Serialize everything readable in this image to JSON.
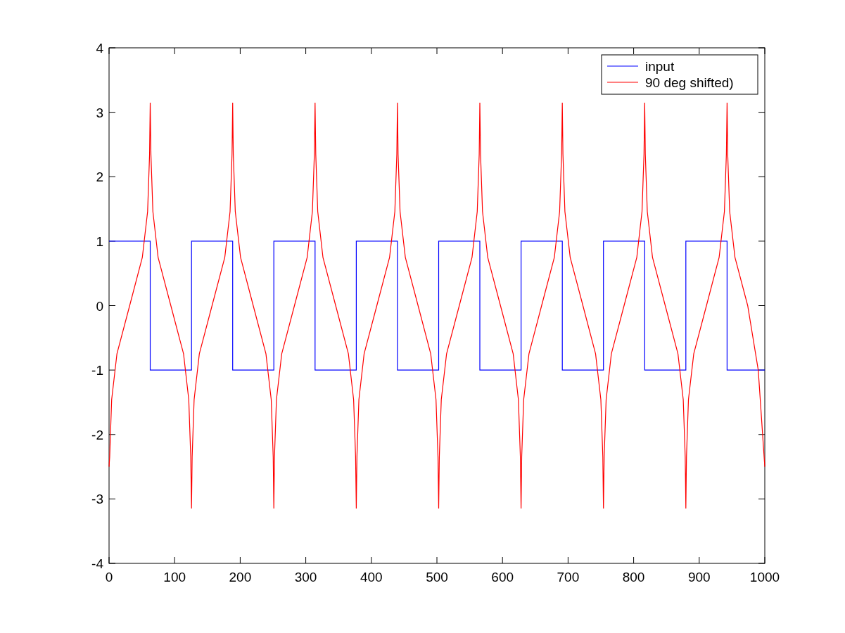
{
  "figure": {
    "chart_data": {
      "type": "line",
      "x": [
        0,
        1,
        4,
        12,
        31.4,
        50.8,
        58.8,
        61.8,
        62.8,
        62.8,
        63.8,
        66.8,
        74.8,
        94.2,
        113.6,
        121.6,
        124.6,
        125.7,
        125.7,
        126.7,
        129.7,
        137.7,
        157.1,
        176.5,
        184.5,
        187.5,
        188.5,
        188.5,
        189.5,
        192.5,
        200.5,
        219.9,
        239.3,
        247.3,
        250.3,
        251.3,
        251.3,
        252.3,
        255.3,
        263.3,
        282.7,
        302.1,
        310.1,
        313.1,
        314.2,
        314.2,
        315.2,
        318.2,
        326.2,
        345.6,
        365,
        373,
        376,
        377,
        377,
        378,
        381,
        389,
        408.4,
        427.8,
        435.8,
        438.8,
        439.8,
        439.8,
        440.8,
        443.8,
        451.8,
        471.2,
        490.6,
        498.6,
        501.6,
        502.7,
        502.7,
        503.7,
        506.7,
        514.7,
        534.1,
        553.5,
        561.5,
        564.5,
        565.5,
        565.5,
        566.5,
        569.5,
        577.5,
        596.9,
        616.3,
        624.3,
        627.3,
        628.3,
        628.3,
        629.3,
        632.3,
        640.3,
        659.7,
        679.1,
        687.1,
        690.1,
        691.2,
        691.2,
        692.2,
        695.2,
        703.2,
        722.6,
        742,
        750,
        753,
        754,
        754,
        755,
        758,
        766,
        785.4,
        804.8,
        812.8,
        815.8,
        816.8,
        816.8,
        817.8,
        820.8,
        828.8,
        848.2,
        867.6,
        875.6,
        878.6,
        879.6,
        879.6,
        880.6,
        883.6,
        891.6,
        911,
        930.4,
        938.4,
        941.4,
        942.5,
        942.5,
        943.5,
        946.5,
        954.5,
        973.9,
        990,
        1000
      ],
      "series": [
        {
          "name": "input",
          "color": "#0000ff",
          "values": [
            1,
            1,
            1,
            1,
            1,
            1,
            1,
            1,
            1,
            -1,
            -1,
            -1,
            -1,
            -1,
            -1,
            -1,
            -1,
            -1,
            1,
            1,
            1,
            1,
            1,
            1,
            1,
            1,
            1,
            -1,
            -1,
            -1,
            -1,
            -1,
            -1,
            -1,
            -1,
            -1,
            1,
            1,
            1,
            1,
            1,
            1,
            1,
            1,
            1,
            -1,
            -1,
            -1,
            -1,
            -1,
            -1,
            -1,
            -1,
            -1,
            1,
            1,
            1,
            1,
            1,
            1,
            1,
            1,
            1,
            -1,
            -1,
            -1,
            -1,
            -1,
            -1,
            -1,
            -1,
            -1,
            1,
            1,
            1,
            1,
            1,
            1,
            1,
            1,
            1,
            -1,
            -1,
            -1,
            -1,
            -1,
            -1,
            -1,
            -1,
            -1,
            1,
            1,
            1,
            1,
            1,
            1,
            1,
            1,
            1,
            -1,
            -1,
            -1,
            -1,
            -1,
            -1,
            -1,
            -1,
            -1,
            1,
            1,
            1,
            1,
            1,
            1,
            1,
            1,
            1,
            -1,
            -1,
            -1,
            -1,
            -1,
            -1,
            -1,
            -1,
            -1,
            1,
            1,
            1,
            1,
            1,
            1,
            1,
            1,
            1,
            -1,
            -1,
            -1,
            -1,
            -1,
            -1,
            -1
          ]
        },
        {
          "name": "90 deg shifted)",
          "color": "#ff0000",
          "values": [
            -2.5,
            -2.35,
            -1.46,
            -0.75,
            0,
            0.75,
            1.46,
            2.35,
            3.15,
            3.15,
            2.35,
            1.46,
            0.75,
            0,
            -0.75,
            -1.46,
            -2.35,
            -3.15,
            -3.15,
            -2.35,
            -1.46,
            -0.75,
            0,
            0.75,
            1.46,
            2.35,
            3.15,
            3.15,
            2.35,
            1.46,
            0.75,
            0,
            -0.75,
            -1.46,
            -2.35,
            -3.15,
            -3.15,
            -2.35,
            -1.46,
            -0.75,
            0,
            0.75,
            1.46,
            2.35,
            3.15,
            3.15,
            2.35,
            1.46,
            0.75,
            0,
            -0.75,
            -1.46,
            -2.35,
            -3.15,
            -3.15,
            -2.35,
            -1.46,
            -0.75,
            0,
            0.75,
            1.46,
            2.35,
            3.15,
            3.15,
            2.35,
            1.46,
            0.75,
            0,
            -0.75,
            -1.46,
            -2.35,
            -3.15,
            -3.15,
            -2.35,
            -1.46,
            -0.75,
            0,
            0.75,
            1.46,
            2.35,
            3.15,
            3.15,
            2.35,
            1.46,
            0.75,
            0,
            -0.75,
            -1.46,
            -2.35,
            -3.15,
            -3.15,
            -2.35,
            -1.46,
            -0.75,
            0,
            0.75,
            1.46,
            2.35,
            3.15,
            3.15,
            2.35,
            1.46,
            0.75,
            0,
            -0.75,
            -1.46,
            -2.35,
            -3.15,
            -3.15,
            -2.35,
            -1.46,
            -0.75,
            0,
            0.75,
            1.46,
            2.35,
            3.15,
            3.15,
            2.35,
            1.46,
            0.75,
            0,
            -0.75,
            -1.46,
            -2.35,
            -3.15,
            -3.15,
            -2.35,
            -1.46,
            -0.75,
            0,
            0.75,
            1.46,
            2.35,
            3.15,
            3.15,
            2.35,
            1.46,
            0.75,
            0,
            -1,
            -2.5
          ]
        }
      ],
      "legend": true,
      "xlim": [
        0,
        1000
      ],
      "ylim": [
        -4,
        4
      ],
      "xticks": [
        0,
        100,
        200,
        300,
        400,
        500,
        600,
        700,
        800,
        900,
        1000
      ],
      "yticks": [
        -4,
        -3,
        -2,
        -1,
        0,
        1,
        2,
        3,
        4
      ]
    }
  }
}
